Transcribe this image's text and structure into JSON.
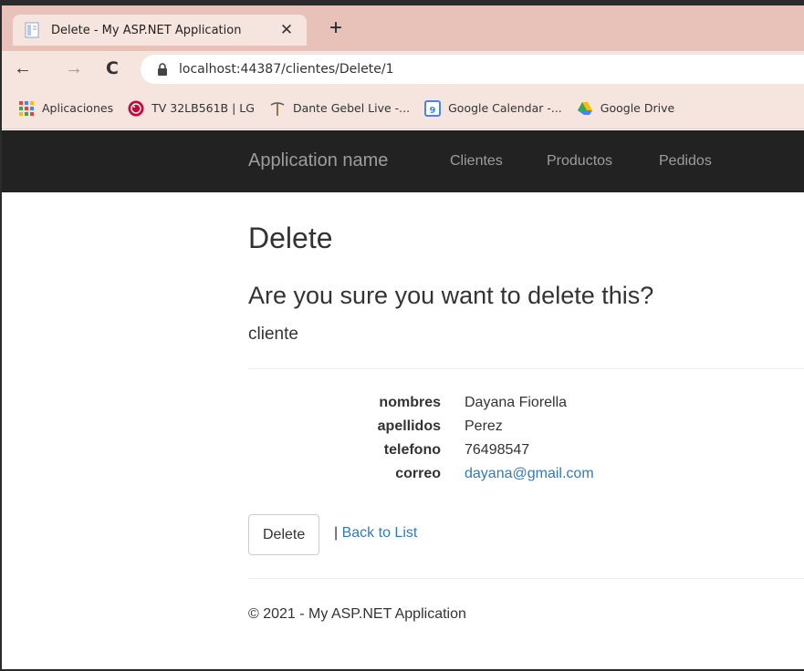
{
  "browser": {
    "tab_title": "Delete - My ASP.NET Application",
    "tab_close": "✕",
    "new_tab": "+",
    "url": "localhost:44387/clientes/Delete/1",
    "back": "←",
    "forward": "→",
    "reload": "C",
    "bookmarks": [
      {
        "label": "Aplicaciones",
        "icon": "apps-grid-icon"
      },
      {
        "label": "TV 32LB561B | LG",
        "icon": "lg-logo-icon"
      },
      {
        "label": "Dante Gebel Live -...",
        "icon": "pickaxe-icon"
      },
      {
        "label": "Google Calendar -...",
        "icon": "calendar-icon"
      },
      {
        "label": "Google Drive",
        "icon": "drive-icon"
      }
    ]
  },
  "navbar": {
    "brand": "Application name",
    "links": [
      "Clientes",
      "Productos",
      "Pedidos"
    ]
  },
  "page": {
    "title": "Delete",
    "confirm": "Are you sure you want to delete this?",
    "entity": "cliente",
    "fields": [
      {
        "label": "nombres",
        "value": "Dayana Fiorella"
      },
      {
        "label": "apellidos",
        "value": "Perez"
      },
      {
        "label": "telefono",
        "value": "76498547"
      },
      {
        "label": "correo",
        "value": "dayana@gmail.com"
      }
    ],
    "delete_button": "Delete",
    "separator": "|",
    "back_link": "Back to List",
    "footer": "© 2021 - My ASP.NET Application"
  },
  "colors": {
    "tab_strip": "#e8c2b8",
    "navbar_bg": "#222222",
    "link": "#337ab7"
  }
}
